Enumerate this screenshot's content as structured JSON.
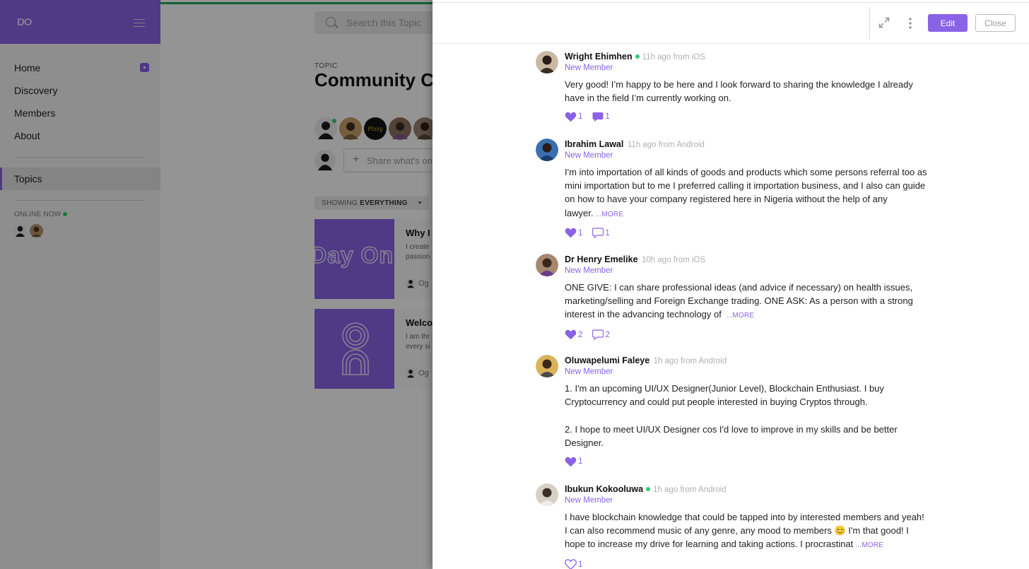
{
  "brand": {
    "logo": "DO"
  },
  "sidebar": {
    "items": [
      {
        "label": "Home"
      },
      {
        "label": "Discovery"
      },
      {
        "label": "Members"
      },
      {
        "label": "About"
      }
    ],
    "topics_label": "Topics",
    "online_now_label": "ONLINE NOW"
  },
  "main": {
    "search_placeholder": "Search this Topic",
    "topic_eyebrow": "TOPIC",
    "topic_title": "Community C",
    "share_placeholder": "Share what's on",
    "filter": {
      "prefix": "SHOWING",
      "value": "EVERYTHING"
    },
    "cards": [
      {
        "title": "Why I",
        "excerpt_1": "I create",
        "excerpt_2": "passion",
        "author": "Og",
        "thumb_text": "Day On"
      },
      {
        "title": "Welco",
        "excerpt_1": "I am thr",
        "excerpt_2": "every si",
        "author": "Og"
      }
    ]
  },
  "panel": {
    "edit_label": "Edit",
    "close_label": "Close",
    "more_label": "...MORE",
    "comments": [
      {
        "name": "Wright Ehimhen",
        "online": true,
        "meta": "11h ago from iOS",
        "role": "New Member",
        "text": "Very good! I’m happy to be here and I look forward to sharing the knowledge I already have in the field I’m currently working on.",
        "truncated": false,
        "likes": "1",
        "replies": "1",
        "replies_filled": true,
        "liked": true
      },
      {
        "name": "Ibrahim Lawal",
        "online": false,
        "meta": "11h ago from Android",
        "role": "New Member",
        "text": "I'm into importation of all kinds of goods and products which some persons referral too as mini importation but to me I preferred calling it importation business, and I also can guide on how to have your company registered here in Nigeria without the help of any lawyer.",
        "truncated": true,
        "likes": "1",
        "replies": "1",
        "replies_filled": false,
        "liked": true
      },
      {
        "name": "Dr Henry Emelike",
        "online": false,
        "meta": "10h ago from iOS",
        "role": "New Member",
        "text": "ONE GIVE: I can share professional ideas (and advice if necessary) on health issues, marketing/selling and Foreign Exchange trading. ONE ASK: As a person with a strong interest in the advancing technology of ",
        "truncated": true,
        "likes": "2",
        "replies": "2",
        "replies_filled": false,
        "liked": true
      },
      {
        "name": "Oluwapelumi Faleye",
        "online": false,
        "meta": "1h ago from Android",
        "role": "New Member",
        "text": "1. I'm an upcoming UI/UX Designer(Junior Level), Blockchain Enthusiast. I buy Cryptocurrency and could put people interested in buying Cryptos through.\n\n2. I hope to meet UI/UX Designer cos I'd love to improve in my skills and be better Designer.",
        "truncated": false,
        "likes": "1",
        "replies": null,
        "replies_filled": false,
        "liked": true
      },
      {
        "name": "Ibukun Kokooluwa",
        "online": true,
        "meta": "1h ago from Android",
        "role": "New Member",
        "text": "I have blockchain knowledge that could be tapped into by interested members and yeah! I can also recommend music of any genre, any mood to members 😊  I'm that good! I hope to increase my drive for learning and taking actions. I procrastinat",
        "truncated": true,
        "likes": "1",
        "replies": null,
        "replies_filled": false,
        "liked": false
      }
    ]
  },
  "colors": {
    "accent": "#8a62e6",
    "online": "#2ecc71",
    "progress": "#1ea656"
  }
}
